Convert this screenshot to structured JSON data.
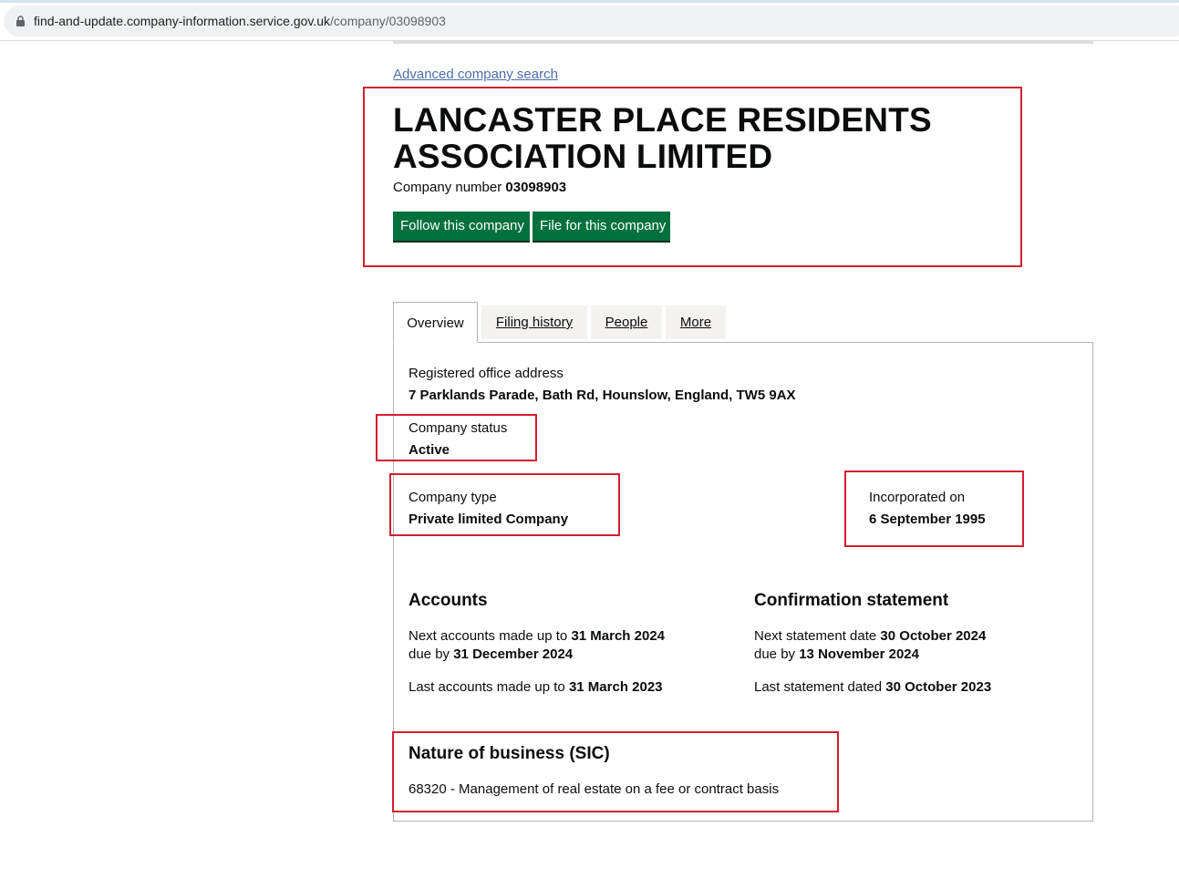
{
  "browser": {
    "url_host": "find-and-update.company-information.service.gov.uk",
    "url_path": "/company/03098903"
  },
  "header": {
    "advanced_search_link": "Advanced company search",
    "company_name": "LANCASTER PLACE RESIDENTS ASSOCIATION LIMITED",
    "company_number_label": "Company number",
    "company_number": "03098903",
    "follow_button": "Follow this company",
    "file_button": "File for this company"
  },
  "tabs": [
    {
      "label": "Overview",
      "active": true
    },
    {
      "label": "Filing history",
      "active": false
    },
    {
      "label": "People",
      "active": false
    },
    {
      "label": "More",
      "active": false
    }
  ],
  "overview": {
    "registered_office_label": "Registered office address",
    "registered_office_value": "7 Parklands Parade, Bath Rd, Hounslow, England, TW5 9AX",
    "status_label": "Company status",
    "status_value": "Active",
    "type_label": "Company type",
    "type_value": "Private limited Company",
    "incorporated_label": "Incorporated on",
    "incorporated_value": "6 September 1995"
  },
  "accounts": {
    "heading": "Accounts",
    "next_made_up_label": "Next accounts made up to",
    "next_made_up_value": "31 March 2024",
    "due_by_label": "due by",
    "due_by_value": "31 December 2024",
    "last_made_up_label": "Last accounts made up to",
    "last_made_up_value": "31 March 2023"
  },
  "confirmation": {
    "heading": "Confirmation statement",
    "next_statement_label": "Next statement date",
    "next_statement_value": "30 October 2024",
    "due_by_label": "due by",
    "due_by_value": "13 November 2024",
    "last_statement_label": "Last statement dated",
    "last_statement_value": "30 October 2023"
  },
  "sic": {
    "heading": "Nature of business (SIC)",
    "item": "68320 - Management of real estate on a fee or contract basis"
  },
  "colors": {
    "button_green": "#00703c",
    "highlight_red": "#d0202f",
    "link_blue": "#4c6ea8"
  }
}
